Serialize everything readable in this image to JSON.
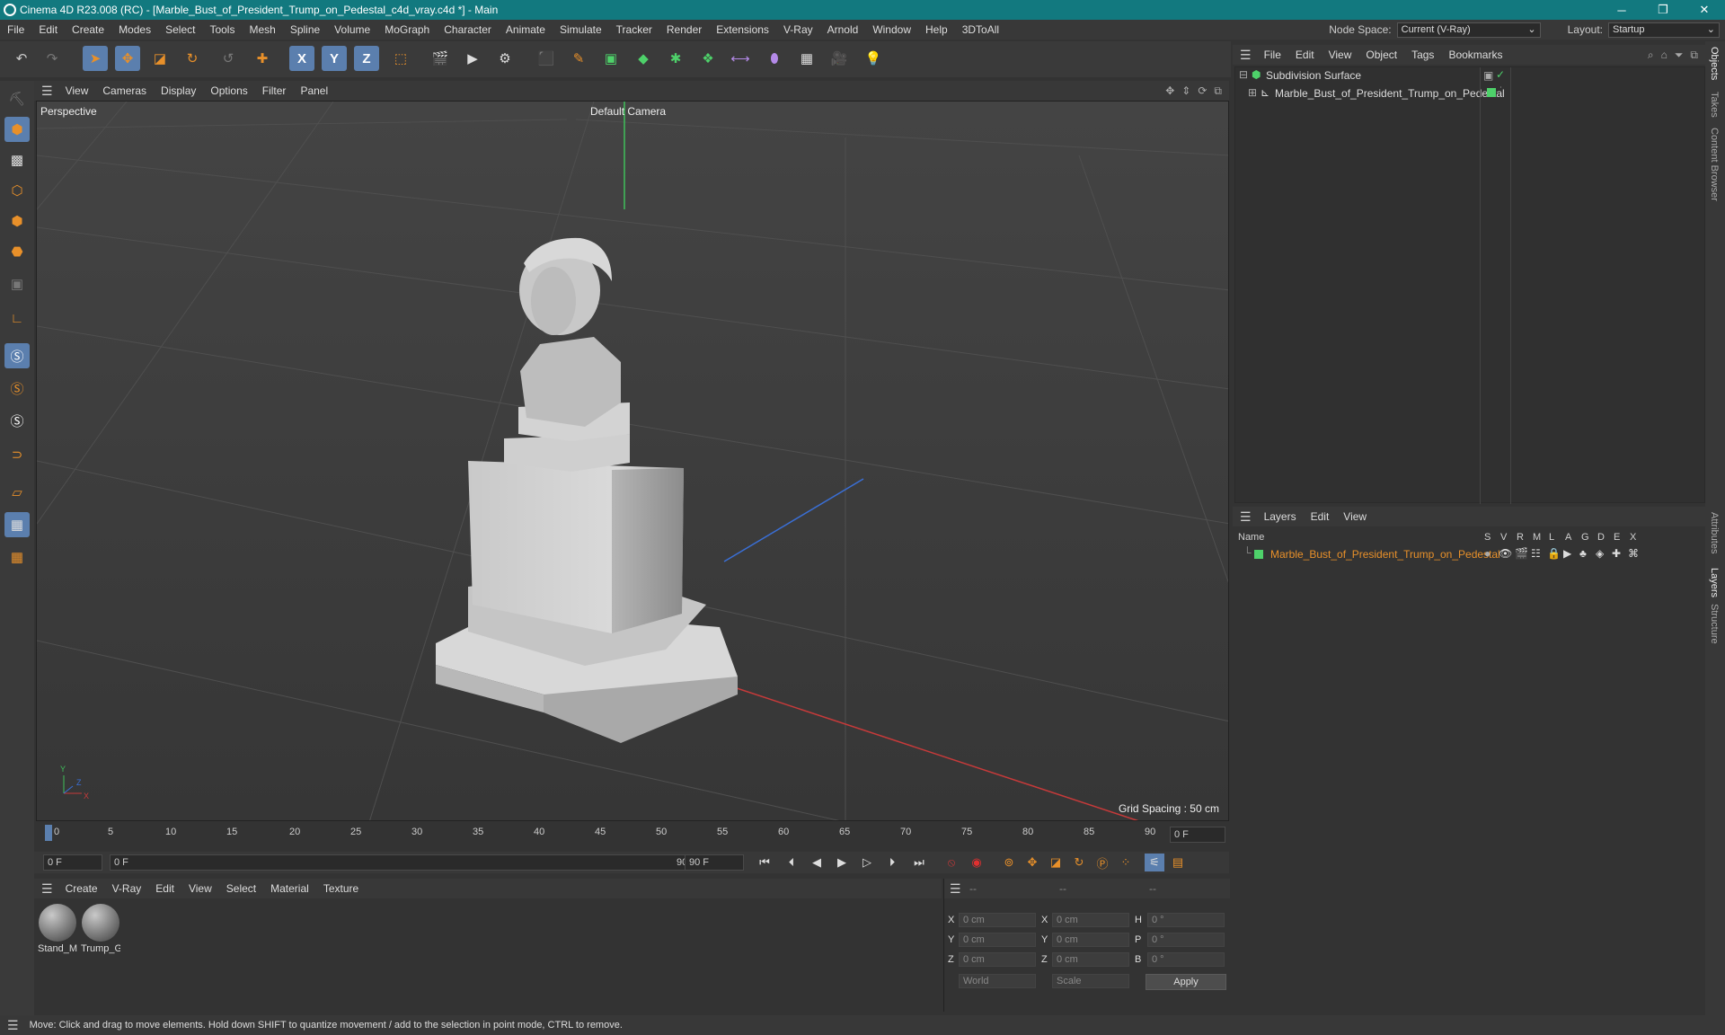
{
  "window": {
    "title": "Cinema 4D R23.008 (RC) - [Marble_Bust_of_President_Trump_on_Pedestal_c4d_vray.c4d *] - Main",
    "min": "─",
    "max": "❐",
    "close": "✕"
  },
  "menubar": {
    "items": [
      "File",
      "Edit",
      "Create",
      "Modes",
      "Select",
      "Tools",
      "Mesh",
      "Spline",
      "Volume",
      "MoGraph",
      "Character",
      "Animate",
      "Simulate",
      "Tracker",
      "Render",
      "Extensions",
      "V-Ray",
      "Arnold",
      "Window",
      "Help",
      "3DToAll"
    ],
    "node_space_label": "Node Space:",
    "node_space_value": "Current (V-Ray)",
    "layout_label": "Layout:",
    "layout_value": "Startup"
  },
  "toolbar": {
    "axis": [
      "X",
      "Y",
      "Z"
    ]
  },
  "viewport": {
    "menu": [
      "View",
      "Cameras",
      "Display",
      "Options",
      "Filter",
      "Panel"
    ],
    "label": "Perspective",
    "camera": "Default Camera",
    "grid_spacing": "Grid Spacing : 50 cm",
    "axis_y": "Y",
    "axis_z": "Z",
    "axis_x": "X"
  },
  "timeline": {
    "ticks": [
      "0",
      "5",
      "10",
      "15",
      "20",
      "25",
      "30",
      "35",
      "40",
      "45",
      "50",
      "55",
      "60",
      "65",
      "70",
      "75",
      "80",
      "85",
      "90"
    ],
    "current_frame": "0 F"
  },
  "transport": {
    "start": "0 F",
    "range_start": "0 F",
    "range_end": "90 F",
    "end": "90 F"
  },
  "materials": {
    "menu": [
      "Create",
      "V-Ray",
      "Edit",
      "View",
      "Select",
      "Material",
      "Texture"
    ],
    "items": [
      {
        "name": "Stand_M"
      },
      {
        "name": "Trump_G"
      }
    ]
  },
  "attributes": {
    "header": [
      "--",
      "--",
      "--"
    ],
    "rows": [
      {
        "a": "X",
        "av": "0 cm",
        "b": "X",
        "bv": "0 cm",
        "c": "H",
        "cv": "0 °"
      },
      {
        "a": "Y",
        "av": "0 cm",
        "b": "Y",
        "bv": "0 cm",
        "c": "P",
        "cv": "0 °"
      },
      {
        "a": "Z",
        "av": "0 cm",
        "b": "Z",
        "bv": "0 cm",
        "c": "B",
        "cv": "0 °"
      }
    ],
    "coord_system": "World",
    "mode": "Scale",
    "apply": "Apply"
  },
  "objects": {
    "menu": [
      "File",
      "Edit",
      "View",
      "Object",
      "Tags",
      "Bookmarks"
    ],
    "items": [
      {
        "name": "Subdivision Surface"
      },
      {
        "name": "Marble_Bust_of_President_Trump_on_Pedestal"
      }
    ]
  },
  "layers": {
    "menu": [
      "Layers",
      "Edit",
      "View"
    ],
    "columns": [
      "Name",
      "S",
      "V",
      "R",
      "M",
      "L",
      "A",
      "G",
      "D",
      "E",
      "X"
    ],
    "items": [
      {
        "name": "Marble_Bust_of_President_Trump_on_Pedestal",
        "color": "#e8902a"
      }
    ]
  },
  "sidetabs": [
    "Objects",
    "Takes",
    "Content Browser",
    "Attributes",
    "Layers",
    "Structure"
  ],
  "status": "Move: Click and drag to move elements. Hold down SHIFT to quantize movement / add to the selection in point mode, CTRL to remove.",
  "colors": {
    "titlebar": "#12797f",
    "accent": "#5b7fae",
    "layer": "#e8902a",
    "green": "#4ed16a"
  }
}
